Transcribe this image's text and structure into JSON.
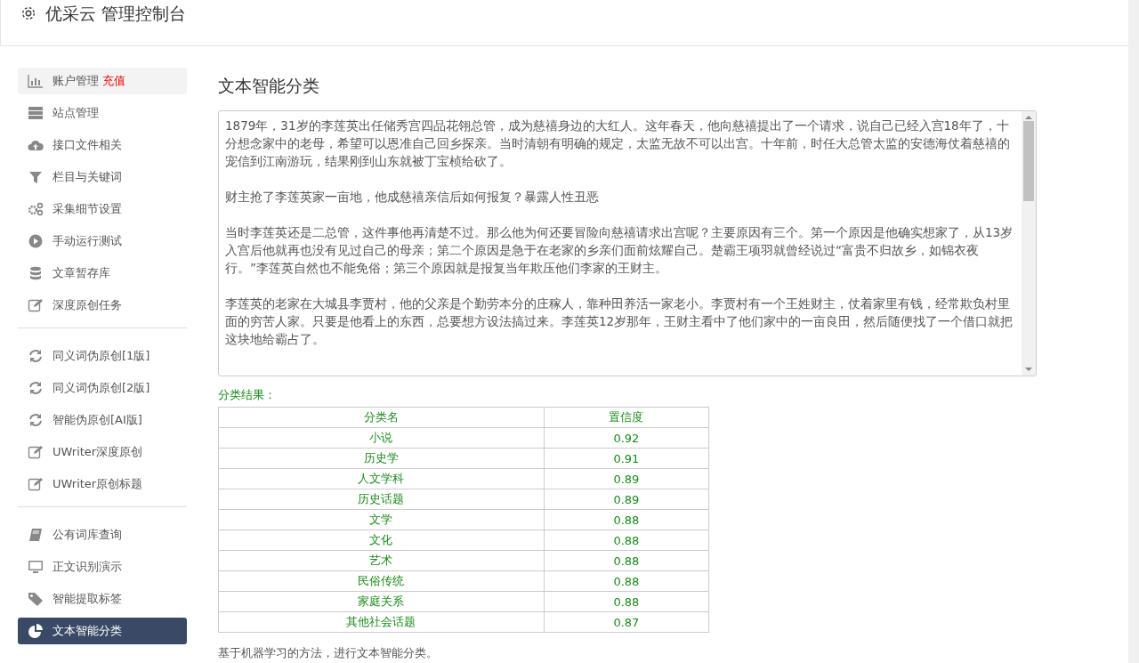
{
  "header": {
    "title": "优采云 管理控制台"
  },
  "sidebar": {
    "groups": [
      {
        "items": [
          {
            "label": "账户管理",
            "badge": "充值",
            "highlighted": true,
            "selected": false
          },
          {
            "label": "站点管理",
            "highlighted": false,
            "selected": false
          },
          {
            "label": "接口文件相关",
            "highlighted": false,
            "selected": false
          },
          {
            "label": "栏目与关键词",
            "highlighted": false,
            "selected": false
          },
          {
            "label": "采集细节设置",
            "highlighted": false,
            "selected": false
          },
          {
            "label": "手动运行测试",
            "highlighted": false,
            "selected": false
          },
          {
            "label": "文章暂存库",
            "highlighted": false,
            "selected": false
          },
          {
            "label": "深度原创任务",
            "highlighted": false,
            "selected": false
          }
        ]
      },
      {
        "items": [
          {
            "label": "同义词伪原创[1版]",
            "highlighted": false,
            "selected": false
          },
          {
            "label": "同义词伪原创[2版]",
            "highlighted": false,
            "selected": false
          },
          {
            "label": "智能伪原创[AI版]",
            "highlighted": false,
            "selected": false
          },
          {
            "label": "UWriter深度原创",
            "highlighted": false,
            "selected": false
          },
          {
            "label": "UWriter原创标题",
            "highlighted": false,
            "selected": false
          }
        ]
      },
      {
        "items": [
          {
            "label": "公有词库查询",
            "highlighted": false,
            "selected": false
          },
          {
            "label": "正文识别演示",
            "highlighted": false,
            "selected": false
          },
          {
            "label": "智能提取标签",
            "highlighted": false,
            "selected": false
          },
          {
            "label": "文本智能分类",
            "highlighted": false,
            "selected": true
          }
        ]
      }
    ]
  },
  "main": {
    "title": "文本智能分类",
    "text_input": {
      "paragraphs": [
        "1879年，31岁的李莲英出任储秀宫四品花翎总管，成为慈禧身边的大红人。这年春天，他向慈禧提出了一个请求，说自己已经入宫18年了，十分想念家中的老母，希望可以恩准自己回乡探亲。当时清朝有明确的规定，太监无故不可以出宫。十年前，时任大总管太监的安德海仗着慈禧的宠信到江南游玩，结果刚到山东就被丁宝桢给砍了。",
        "财主抢了李莲英家一亩地，他成慈禧亲信后如何报复？暴露人性丑恶",
        "当时李莲英还是二总管，这件事他再清楚不过。那么他为何还要冒险向慈禧请求出宫呢？主要原因有三个。第一个原因是他确实想家了，从13岁入宫后他就再也没有见过自己的母亲；第二个原因是急于在老家的乡亲们面前炫耀自己。楚霸王项羽就曾经说过“富贵不归故乡，如锦衣夜行。”李莲英自然也不能免俗；第三个原因就是报复当年欺压他们李家的王财主。",
        "李莲英的老家在大城县李贾村，他的父亲是个勤劳本分的庄稼人，靠种田养活一家老小。李贾村有一个王姓财主，仗着家里有钱，经常欺负村里面的穷苦人家。只要是他看上的东西，总要想方设法搞过来。李莲英12岁那年，王财主看中了他们家中的一亩良田，然后随便找了一个借口就把这块地给霸占了。"
      ]
    },
    "result_label": "分类结果：",
    "results": {
      "columns": [
        "分类名",
        "置信度"
      ],
      "rows": [
        [
          "小说",
          "0.92"
        ],
        [
          "历史学",
          "0.91"
        ],
        [
          "人文学科",
          "0.89"
        ],
        [
          "历史话题",
          "0.89"
        ],
        [
          "文学",
          "0.88"
        ],
        [
          "文化",
          "0.88"
        ],
        [
          "艺术",
          "0.88"
        ],
        [
          "民俗传统",
          "0.88"
        ],
        [
          "家庭关系",
          "0.88"
        ],
        [
          "其他社会话题",
          "0.87"
        ]
      ]
    },
    "description": "基于机器学习的方法，进行文本智能分类。"
  }
}
